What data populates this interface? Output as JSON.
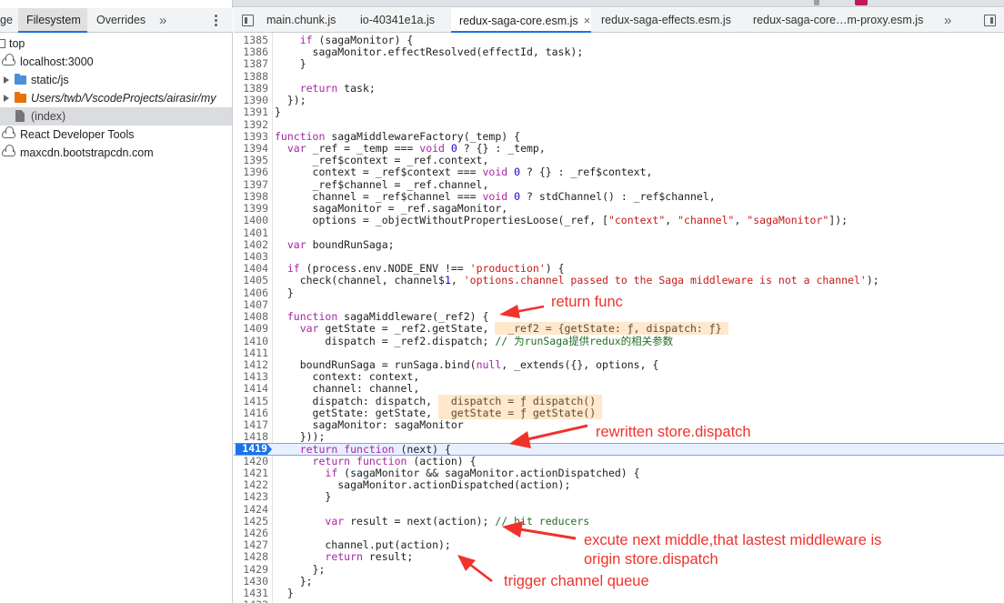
{
  "navigator": {
    "tabs": [
      {
        "label": "ge",
        "active": false
      },
      {
        "label": "Filesystem",
        "active": true
      },
      {
        "label": "Overrides",
        "active": false
      }
    ],
    "more_tabs_icon": "chevron-double-right-icon",
    "menu_icon": "kebab-menu-icon",
    "tree": [
      {
        "label": "top",
        "icon": "frame-icon",
        "selected": false,
        "italic": false
      },
      {
        "label": "localhost:3000",
        "icon": "cloud-icon",
        "selected": false,
        "italic": false
      },
      {
        "label": "static/js",
        "icon": "folder-icon",
        "folder_color": "#4a90d9",
        "selected": false,
        "italic": false
      },
      {
        "label": "Users/twb/VscodeProjects/airasir/my",
        "icon": "folder-icon",
        "folder_color": "#e8710a",
        "selected": false,
        "italic": true
      },
      {
        "label": "(index)",
        "icon": "file-icon",
        "selected": true,
        "italic": false
      },
      {
        "label": "React Developer Tools",
        "icon": "cloud-icon",
        "selected": false,
        "italic": false
      },
      {
        "label": "maxcdn.bootstrapcdn.com",
        "icon": "cloud-icon",
        "selected": false,
        "italic": false
      }
    ]
  },
  "editor": {
    "toggle_navigator_icon": "sidebar-toggle-icon",
    "tabs": [
      {
        "label": "main.chunk.js",
        "active": false
      },
      {
        "label": "io-40341e1a.js",
        "active": false
      },
      {
        "label": "redux-saga-core.esm.js",
        "active": true
      },
      {
        "label": "redux-saga-effects.esm.js",
        "active": false
      },
      {
        "label": "redux-saga-core…m-proxy.esm.js",
        "active": false
      }
    ],
    "close_icon_text": "×",
    "more_tabs_text": "»",
    "toggle_debugger_icon": "debugger-sidebar-icon",
    "execution_line": "1419",
    "lines": [
      {
        "n": "1385",
        "code": "    if (sagaMonitor) {"
      },
      {
        "n": "1386",
        "code": "      sagaMonitor.effectResolved(effectId, task);"
      },
      {
        "n": "1387",
        "code": "    }"
      },
      {
        "n": "1388",
        "code": ""
      },
      {
        "n": "1389",
        "code": "    return task;"
      },
      {
        "n": "1390",
        "code": "  });"
      },
      {
        "n": "1391",
        "code": "}"
      },
      {
        "n": "1392",
        "code": ""
      },
      {
        "n": "1393",
        "code": "function sagaMiddlewareFactory(_temp) {"
      },
      {
        "n": "1394",
        "code": "  var _ref = _temp === void 0 ? {} : _temp,"
      },
      {
        "n": "1395",
        "code": "      _ref$context = _ref.context,"
      },
      {
        "n": "1396",
        "code": "      context = _ref$context === void 0 ? {} : _ref$context,"
      },
      {
        "n": "1397",
        "code": "      _ref$channel = _ref.channel,"
      },
      {
        "n": "1398",
        "code": "      channel = _ref$channel === void 0 ? stdChannel() : _ref$channel,"
      },
      {
        "n": "1399",
        "code": "      sagaMonitor = _ref.sagaMonitor,"
      },
      {
        "n": "1400",
        "code": "      options = _objectWithoutPropertiesLoose(_ref, [\"context\", \"channel\", \"sagaMonitor\"]);"
      },
      {
        "n": "1401",
        "code": ""
      },
      {
        "n": "1402",
        "code": "  var boundRunSaga;"
      },
      {
        "n": "1403",
        "code": ""
      },
      {
        "n": "1404",
        "code": "  if (process.env.NODE_ENV !== 'production') {"
      },
      {
        "n": "1405",
        "code": "    check(channel, channel$1, 'options.channel passed to the Saga middleware is not a channel');"
      },
      {
        "n": "1406",
        "code": "  }"
      },
      {
        "n": "1407",
        "code": ""
      },
      {
        "n": "1408",
        "code": "  function sagaMiddleware(_ref2) {"
      },
      {
        "n": "1409",
        "code": "    var getState = _ref2.getState,",
        "inline": "_ref2 = {getState: ƒ, dispatch: ƒ}"
      },
      {
        "n": "1410",
        "code": "        dispatch = _ref2.dispatch; // 为runSaga提供redux的相关参数"
      },
      {
        "n": "1411",
        "code": ""
      },
      {
        "n": "1412",
        "code": "    boundRunSaga = runSaga.bind(null, _extends({}, options, {"
      },
      {
        "n": "1413",
        "code": "      context: context,"
      },
      {
        "n": "1414",
        "code": "      channel: channel,"
      },
      {
        "n": "1415",
        "code": "      dispatch: dispatch,",
        "inline": "dispatch = ƒ dispatch()"
      },
      {
        "n": "1416",
        "code": "      getState: getState,",
        "inline": "getState = ƒ getState()"
      },
      {
        "n": "1417",
        "code": "      sagaMonitor: sagaMonitor"
      },
      {
        "n": "1418",
        "code": "    }));"
      },
      {
        "n": "1419",
        "code": "    return function (next) {"
      },
      {
        "n": "1420",
        "code": "      return function (action) {"
      },
      {
        "n": "1421",
        "code": "        if (sagaMonitor && sagaMonitor.actionDispatched) {"
      },
      {
        "n": "1422",
        "code": "          sagaMonitor.actionDispatched(action);"
      },
      {
        "n": "1423",
        "code": "        }"
      },
      {
        "n": "1424",
        "code": ""
      },
      {
        "n": "1425",
        "code": "        var result = next(action); // hit reducers"
      },
      {
        "n": "1426",
        "code": ""
      },
      {
        "n": "1427",
        "code": "        channel.put(action);"
      },
      {
        "n": "1428",
        "code": "        return result;"
      },
      {
        "n": "1429",
        "code": "      };"
      },
      {
        "n": "1430",
        "code": "    };"
      },
      {
        "n": "1431",
        "code": "  }"
      },
      {
        "n": "1432",
        "code": ""
      }
    ]
  },
  "annotations": [
    {
      "text": "return func"
    },
    {
      "text": "rewritten store.dispatch"
    },
    {
      "text": "excute next middle,that lastest middleware is"
    },
    {
      "text": "origin store.dispatch"
    },
    {
      "text": "trigger channel queue"
    }
  ],
  "colors": {
    "annotation": "#f0322b",
    "accent": "#1a73e8",
    "keyword": "#a626a4",
    "string": "#c41a16",
    "number": "#1c00cf",
    "comment": "#236e25",
    "inline_value_bg": "#ffe8cc"
  }
}
